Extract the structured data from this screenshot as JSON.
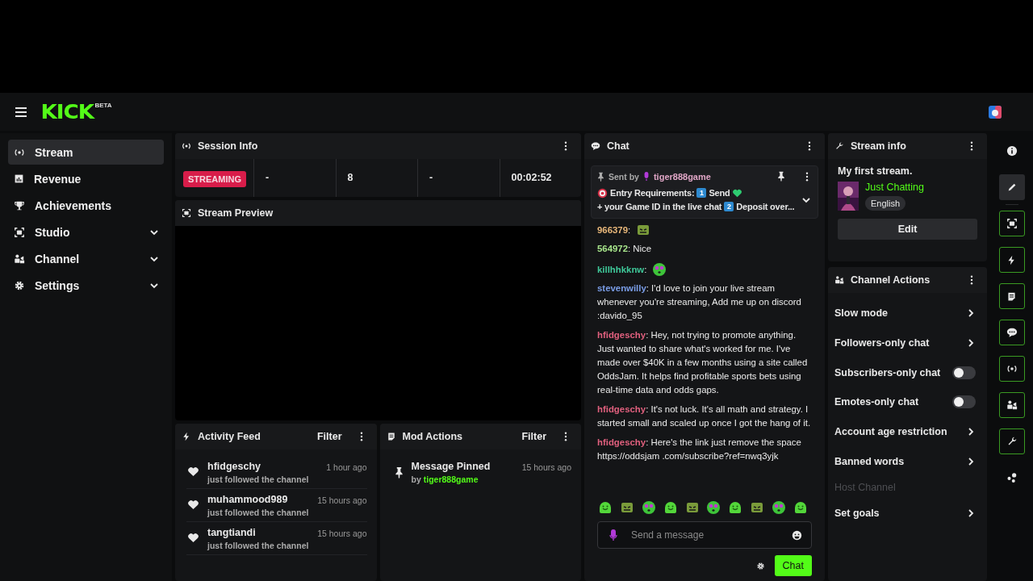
{
  "header": {
    "logo": "KICK",
    "logo_badge": "BETA"
  },
  "sidebar": {
    "items": [
      {
        "label": "Stream",
        "selected": true
      },
      {
        "label": "Revenue",
        "selected": false
      },
      {
        "label": "Achievements",
        "selected": false
      },
      {
        "label": "Studio",
        "selected": false,
        "expanded": false
      },
      {
        "label": "Channel",
        "selected": false,
        "expanded": false
      },
      {
        "label": "Settings",
        "selected": false,
        "expanded": false
      }
    ]
  },
  "session_info": {
    "title": "Session Info",
    "status": "STREAMING",
    "stats": [
      {
        "value": "-"
      },
      {
        "value": "8"
      },
      {
        "value": "-"
      },
      {
        "value": "00:02:52"
      }
    ]
  },
  "stream_preview": {
    "title": "Stream Preview"
  },
  "activity_feed": {
    "title": "Activity Feed",
    "filter": "Filter",
    "items": [
      {
        "user": "hfidgeschy",
        "action": "just followed the channel",
        "time": "1 hour ago"
      },
      {
        "user": "muhammood989",
        "action": "just followed the channel",
        "time": "15 hours ago"
      },
      {
        "user": "tangtiandi",
        "action": "just followed the channel",
        "time": "15 hours ago"
      }
    ]
  },
  "mod_actions": {
    "title": "Mod Actions",
    "filter": "Filter",
    "items": [
      {
        "action": "Message Pinned",
        "by": "by",
        "user": "tiger888game",
        "time": "15 hours ago"
      }
    ]
  },
  "chat": {
    "title": "Chat",
    "pinned": {
      "sent_by": "Sent by",
      "user": "tiger888game",
      "parts": [
        {
          "kind": "target"
        },
        {
          "kind": "text",
          "text": "Entry Requirements:"
        },
        {
          "kind": "key",
          "text": "1"
        },
        {
          "kind": "text",
          "text": "Send"
        },
        {
          "kind": "heart"
        },
        {
          "kind": "text",
          "text": "+ your Game ID in the live chat"
        },
        {
          "kind": "key",
          "text": "2"
        },
        {
          "kind": "text",
          "text": "Deposit over..."
        }
      ]
    },
    "messages": [
      {
        "kind": "emote",
        "user": "966379",
        "color": "#e8b77a",
        "text": ":"
      },
      {
        "kind": "text",
        "user": "564972",
        "color": "#a6e38a",
        "text": ": Nice"
      },
      {
        "kind": "emote",
        "user": "killhhkknw",
        "color": "#3fc99a",
        "text": ":"
      },
      {
        "kind": "text",
        "user": "stevenwilly",
        "color": "#7b9ee8",
        "text": ": I'd love to join your live stream whenever you're streaming, Add me up on discord :davido_95"
      },
      {
        "kind": "text",
        "user": "hfidgeschy",
        "color": "#e0607e",
        "text": ": Hey, not trying to promote anything. Just wanted to share what's worked for me. I've made over $40K in a few months using a site called OddsJam. It helps find profitable sports bets using real-time data and odds gaps."
      },
      {
        "kind": "text",
        "user": "hfidgeschy",
        "color": "#e0607e",
        "text": ": It's not luck. It's all math and strategy. I started small and scaled up once I got the hang of it."
      },
      {
        "kind": "text",
        "user": "hfidgeschy",
        "color": "#e0607e",
        "text": ": Here's the link just remove the space https://oddsjam .com/subscribe?ref=nwq3yjk"
      }
    ],
    "input": {
      "placeholder": "Send a message"
    },
    "send": "Chat"
  },
  "stream_info": {
    "title": "Stream info",
    "stream_title": "My first stream.",
    "category": "Just Chatting",
    "language": "English",
    "edit": "Edit"
  },
  "channel_actions": {
    "title": "Channel Actions",
    "items": [
      {
        "label": "Slow mode",
        "kind": "link",
        "disabled": false
      },
      {
        "label": "Followers-only chat",
        "kind": "link",
        "disabled": false
      },
      {
        "label": "Subscribers-only chat",
        "kind": "toggle",
        "on": false,
        "disabled": false
      },
      {
        "label": "Emotes-only chat",
        "kind": "toggle",
        "on": false,
        "disabled": false
      },
      {
        "label": "Account age restriction",
        "kind": "link",
        "disabled": false
      },
      {
        "label": "Banned words",
        "kind": "link",
        "disabled": false
      },
      {
        "label": "Host Channel",
        "kind": "plain",
        "disabled": true
      },
      {
        "label": "Set goals",
        "kind": "link",
        "disabled": false
      }
    ]
  },
  "rail": [
    {
      "kind": "info",
      "selected": false,
      "active": false
    },
    {
      "kind": "pencil",
      "selected": true,
      "active": false
    },
    {
      "kind": "preview",
      "selected": false,
      "active": true
    },
    {
      "kind": "bolt",
      "selected": false,
      "active": true
    },
    {
      "kind": "note",
      "selected": false,
      "active": true
    },
    {
      "kind": "chat",
      "selected": false,
      "active": true
    },
    {
      "kind": "live",
      "selected": false,
      "active": true
    },
    {
      "kind": "channel",
      "selected": false,
      "active": true
    },
    {
      "kind": "wrench",
      "selected": false,
      "active": true
    },
    {
      "kind": "dots",
      "selected": false,
      "active": false
    }
  ]
}
